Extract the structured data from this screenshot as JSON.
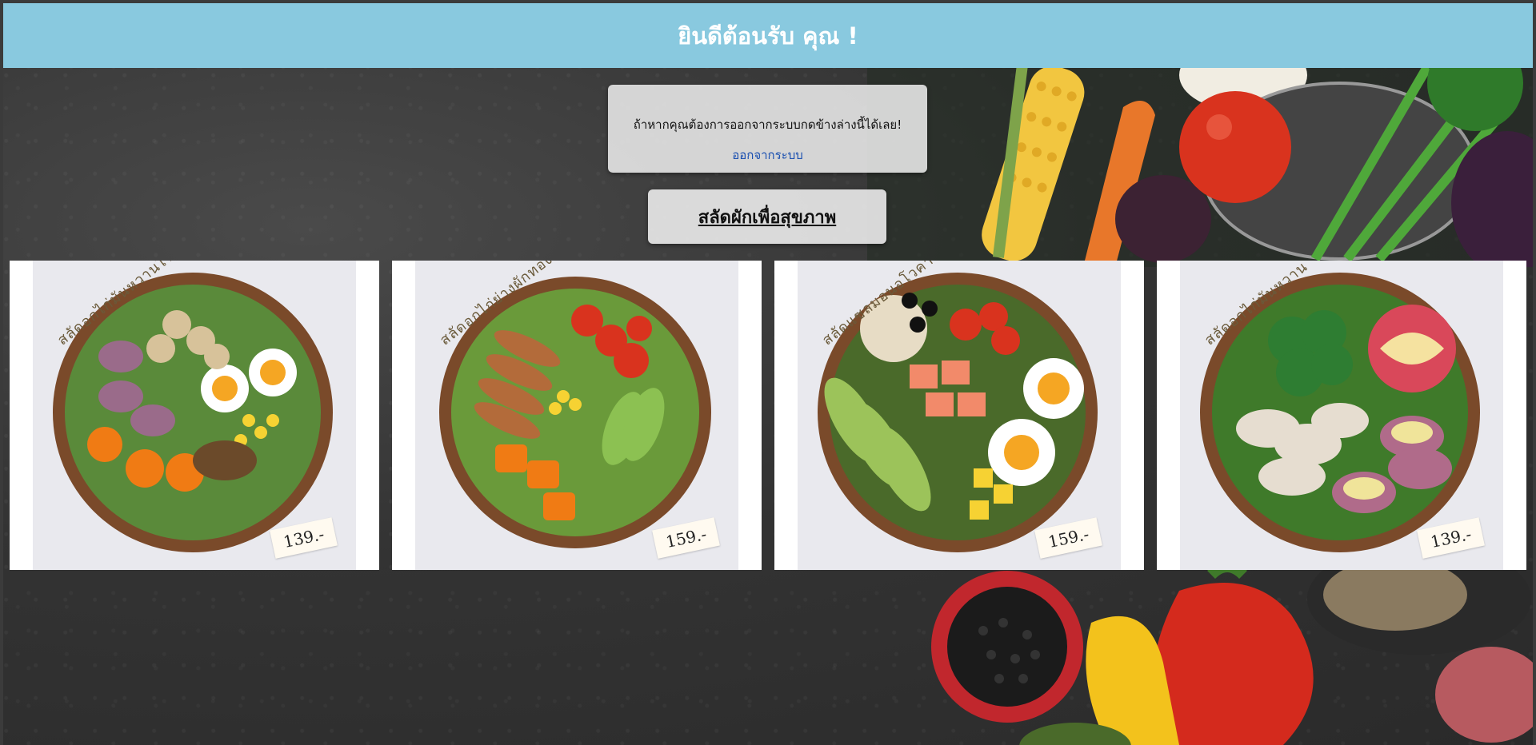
{
  "header": {
    "title": "ยินดีต้อนรับ คุณ !"
  },
  "logout": {
    "message": "ถ้าหากคุณต้องการออกจากระบบกดข้างล่างนี้ได้เลย!",
    "link_label": "ออกจากระบบ"
  },
  "section": {
    "title": "สลัดผักเพื่อสุขภาพ"
  },
  "products": [
    {
      "name": "สลัดอกไก่มันหวานไข่ต้ม",
      "price": "139.-"
    },
    {
      "name": "สลัดอกไก่ย่างผักทอง",
      "price": "159.-"
    },
    {
      "name": "สลัดแซลมอนอโวคาโด",
      "price": "159.-"
    },
    {
      "name": "สลัดอกไก่มันหวาน",
      "price": "139.-"
    }
  ],
  "colors": {
    "header_bg": "#89c9df",
    "link": "#1a4fb0"
  }
}
